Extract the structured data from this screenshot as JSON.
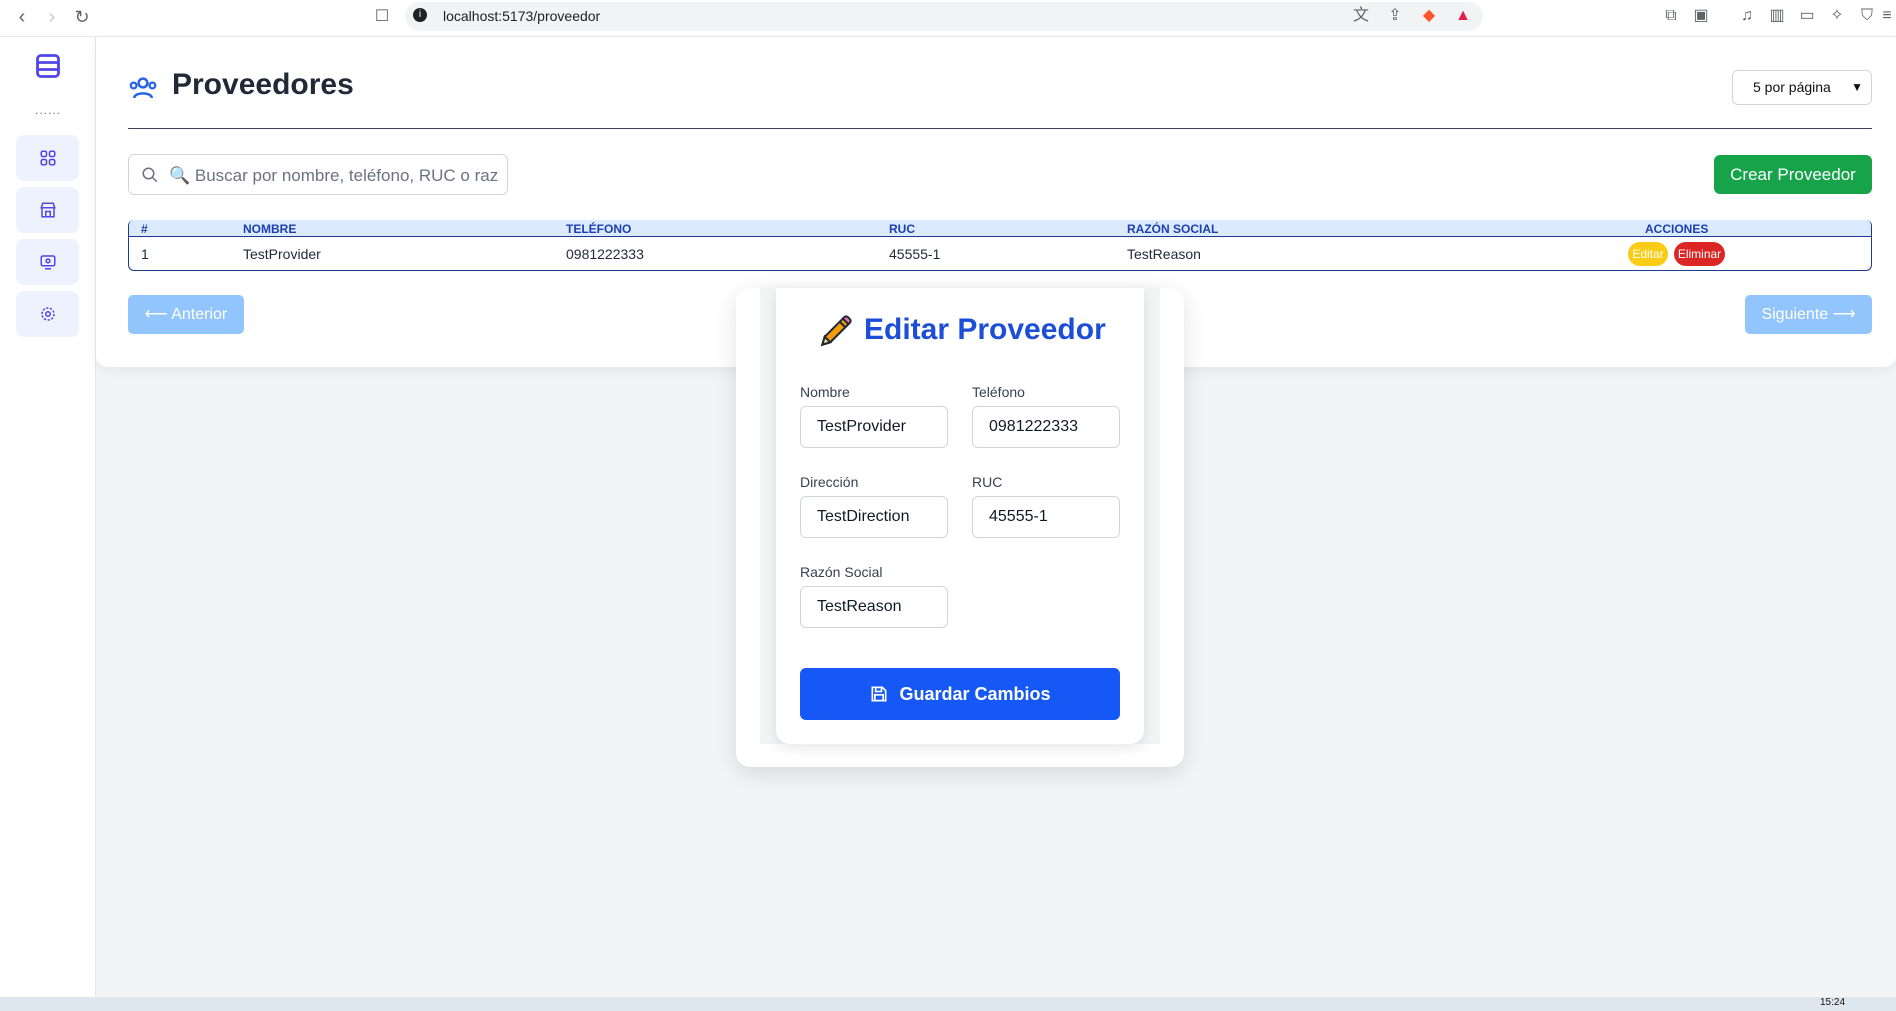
{
  "browser": {
    "url": "localhost:5173/proveedor"
  },
  "sidebar": {
    "dots": "......",
    "items": [
      {
        "icon": "grid-icon"
      },
      {
        "icon": "store-icon"
      },
      {
        "icon": "monitor-icon"
      },
      {
        "icon": "gear-icon"
      }
    ]
  },
  "header": {
    "title": "Proveedores",
    "per_page": "5 por página"
  },
  "search": {
    "placeholder": "🔍 Buscar por nombre, teléfono, RUC o razón social"
  },
  "toolbar": {
    "create_label": "Crear Proveedor"
  },
  "table": {
    "columns": [
      "#",
      "NOMBRE",
      "TELÉFONO",
      "RUC",
      "RAZÓN SOCIAL",
      "ACCIONES"
    ],
    "rows": [
      {
        "num": "1",
        "nombre": "TestProvider",
        "telefono": "0981222333",
        "ruc": "45555-1",
        "razon": "TestReason",
        "edit_label": "Editar",
        "delete_label": "Eliminar"
      }
    ]
  },
  "pagination": {
    "prev_label": "⟵ Anterior",
    "next_label": "Siguiente ⟶"
  },
  "modal": {
    "title": "Editar Proveedor",
    "fields": {
      "nombre": {
        "label": "Nombre",
        "value": "TestProvider"
      },
      "telefono": {
        "label": "Teléfono",
        "value": "0981222333"
      },
      "direccion": {
        "label": "Dirección",
        "value": "TestDirection"
      },
      "ruc": {
        "label": "RUC",
        "value": "45555-1"
      },
      "razon": {
        "label": "Razón Social",
        "value": "TestReason"
      }
    },
    "save_label": "Guardar Cambios"
  },
  "taskbar": {
    "time": "15:24"
  },
  "colors": {
    "accent": "#1d4ed8",
    "create": "#16a34a",
    "edit_badge": "#facc15",
    "delete_badge": "#dc2626",
    "save": "#1558f6"
  }
}
